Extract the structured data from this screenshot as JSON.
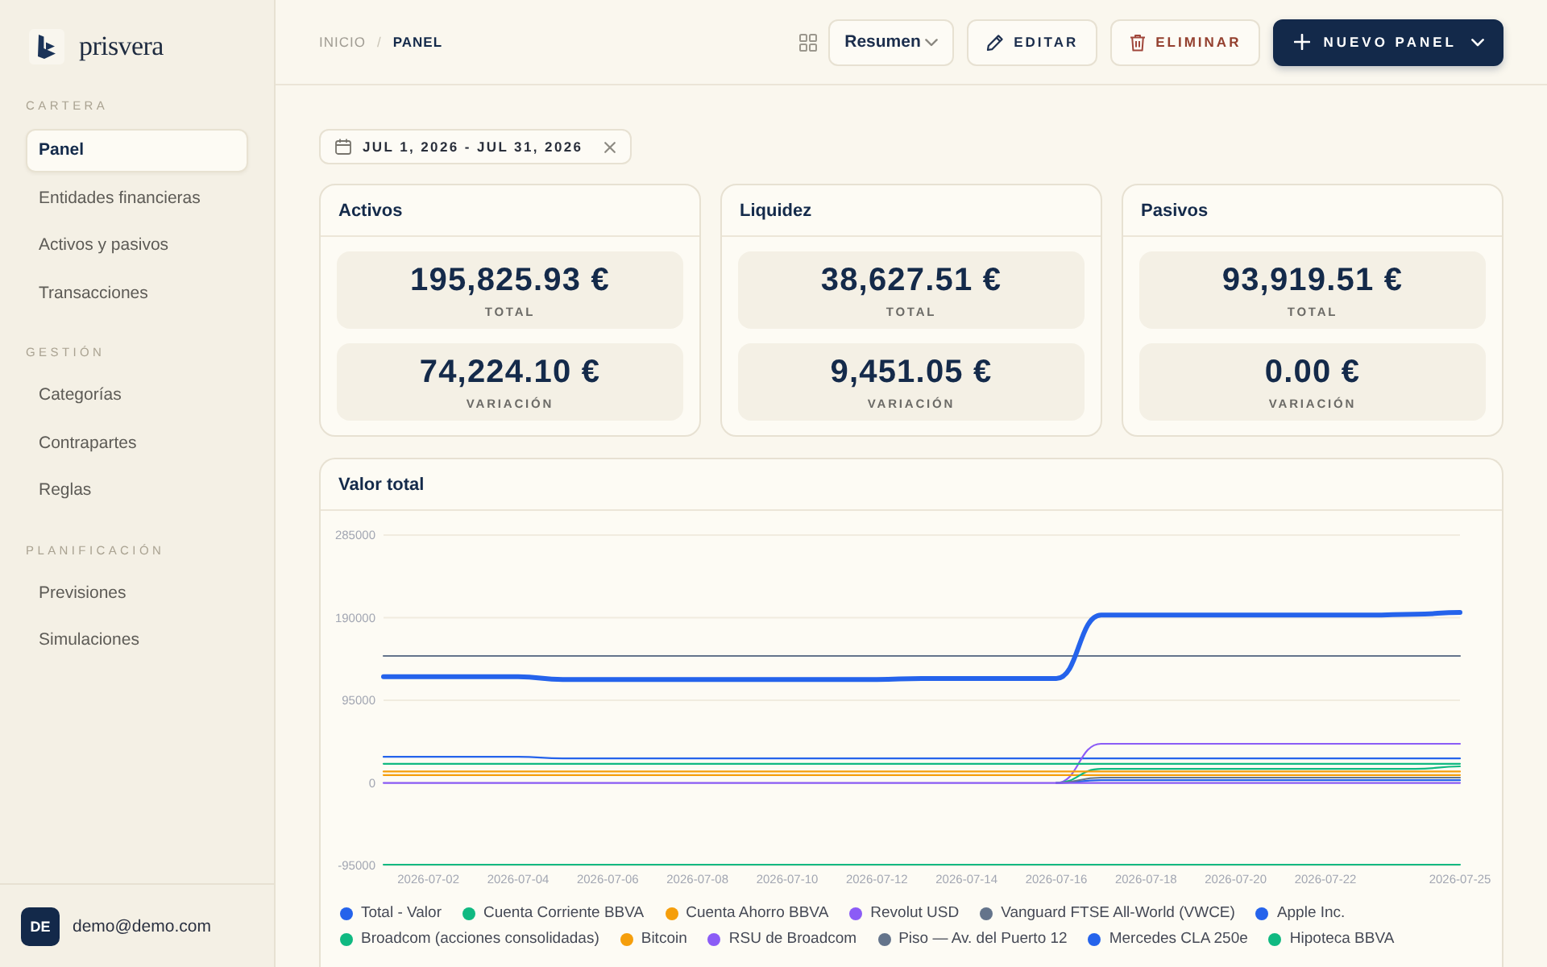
{
  "sidebar": {
    "logo": {
      "text": "prisvera"
    },
    "sections": [
      {
        "title": "CARTERA",
        "items": [
          {
            "label": "Panel",
            "selected": true
          },
          {
            "label": "Entidades financieras",
            "selected": false
          },
          {
            "label": "Activos y pasivos",
            "selected": false
          },
          {
            "label": "Transacciones",
            "selected": false
          }
        ]
      },
      {
        "title": "GESTIÓN",
        "items": [
          {
            "label": "Categorías",
            "selected": false
          },
          {
            "label": "Contrapartes",
            "selected": false
          },
          {
            "label": "Reglas",
            "selected": false
          }
        ]
      },
      {
        "title": "PLANIFICACIÓN",
        "items": [
          {
            "label": "Previsiones",
            "selected": false
          },
          {
            "label": "Simulaciones",
            "selected": false
          }
        ]
      }
    ],
    "user": {
      "initials": "DE",
      "email": "demo@demo.com"
    }
  },
  "breadcrumb": {
    "separator": "/",
    "items": [
      {
        "label": "INICIO",
        "current": false
      },
      {
        "label": "PANEL",
        "current": true
      }
    ]
  },
  "toolbar": {
    "view_select": {
      "value": "Resumen"
    },
    "buttons": [
      {
        "label": "EDITAR",
        "kind": "edit"
      },
      {
        "label": "ELIMINAR",
        "kind": "delete"
      },
      {
        "label": "NUEVO PANEL",
        "kind": "primary"
      }
    ]
  },
  "date_filter": {
    "value": "JUL 1, 2026 - JUL 31, 2026"
  },
  "cards": [
    {
      "title": "Activos",
      "stats": [
        {
          "value": "195,825.93 €",
          "label": "TOTAL"
        },
        {
          "value": "74,224.10 €",
          "label": "VARIACIÓN"
        }
      ]
    },
    {
      "title": "Liquidez",
      "stats": [
        {
          "value": "38,627.51 €",
          "label": "TOTAL"
        },
        {
          "value": "9,451.05 €",
          "label": "VARIACIÓN"
        }
      ]
    },
    {
      "title": "Pasivos",
      "stats": [
        {
          "value": "93,919.51 €",
          "label": "TOTAL"
        },
        {
          "value": "0.00 €",
          "label": "VARIACIÓN"
        }
      ]
    }
  ],
  "chart_card": {
    "title": "Valor total",
    "chart_data": {
      "type": "line",
      "categories": [
        null,
        "2026-07-02",
        null,
        "2026-07-04",
        null,
        "2026-07-06",
        null,
        "2026-07-08",
        null,
        "2026-07-10",
        null,
        "2026-07-12",
        null,
        "2026-07-14",
        null,
        "2026-07-16",
        null,
        "2026-07-18",
        null,
        "2026-07-20",
        null,
        "2026-07-22",
        null,
        null,
        "2026-07-25"
      ],
      "ylim": [
        -95000,
        285000
      ],
      "yticks": [
        -95000,
        0,
        95000,
        190000,
        285000
      ],
      "series": [
        {
          "name": "Total - Valor",
          "color": "#2563eb",
          "values": [
            122000,
            122000,
            122000,
            122000,
            119000,
            119000,
            119000,
            119000,
            119000,
            119000,
            119000,
            119000,
            120000,
            120000,
            120000,
            120000,
            193000,
            193000,
            193000,
            193000,
            193000,
            193000,
            193000,
            194000,
            196000
          ]
        },
        {
          "name": "Cuenta Corriente BBVA",
          "color": "#10b981",
          "values": [
            22000,
            22000,
            22000,
            22000,
            22000,
            22000,
            22000,
            22000,
            22000,
            22000,
            22000,
            22000,
            22000,
            22000,
            22000,
            22000,
            22000,
            22000,
            22000,
            22000,
            22000,
            22000,
            22000,
            22000,
            22000
          ]
        },
        {
          "name": "Cuenta Ahorro BBVA",
          "color": "#f59e0b",
          "values": [
            13000,
            13000,
            13000,
            13000,
            13000,
            13000,
            13000,
            13000,
            13000,
            13000,
            13000,
            13000,
            13000,
            13000,
            13000,
            13000,
            13000,
            13000,
            13000,
            13000,
            13000,
            13000,
            13000,
            13000,
            13000
          ]
        },
        {
          "name": "Revolut USD",
          "color": "#8b5cf6",
          "values": [
            0,
            0,
            0,
            0,
            0,
            0,
            0,
            0,
            0,
            0,
            0,
            0,
            0,
            0,
            0,
            0,
            0,
            0,
            0,
            0,
            0,
            0,
            0,
            0,
            0
          ]
        },
        {
          "name": "Vanguard FTSE All-World (VWCE)",
          "color": "#64748b",
          "values": [
            null,
            null,
            null,
            null,
            null,
            null,
            null,
            null,
            null,
            null,
            null,
            null,
            null,
            null,
            null,
            0,
            6000,
            6000,
            6000,
            6000,
            6000,
            6000,
            6000,
            6000,
            6000
          ]
        },
        {
          "name": "Apple Inc.",
          "color": "#2563eb",
          "values": [
            null,
            null,
            null,
            null,
            null,
            null,
            null,
            null,
            null,
            null,
            null,
            null,
            null,
            null,
            null,
            0,
            3000,
            3000,
            3000,
            3000,
            3000,
            3000,
            3000,
            3000,
            3000
          ]
        },
        {
          "name": "Broadcom (acciones consolidadas)",
          "color": "#10b981",
          "values": [
            null,
            null,
            null,
            null,
            null,
            null,
            null,
            null,
            null,
            null,
            null,
            null,
            null,
            null,
            null,
            0,
            16000,
            16000,
            16000,
            16000,
            16000,
            16000,
            16000,
            16000,
            19000
          ]
        },
        {
          "name": "Bitcoin",
          "color": "#f59e0b",
          "values": [
            9000,
            9000,
            9000,
            9000,
            9000,
            9000,
            9000,
            9000,
            9000,
            9000,
            9000,
            9000,
            9000,
            9000,
            9000,
            9000,
            9000,
            9000,
            9000,
            9000,
            9000,
            9000,
            9000,
            9000,
            9000
          ]
        },
        {
          "name": "RSU de Broadcom",
          "color": "#8b5cf6",
          "values": [
            null,
            null,
            null,
            null,
            null,
            null,
            null,
            null,
            null,
            null,
            null,
            null,
            null,
            null,
            null,
            0,
            45000,
            45000,
            45000,
            45000,
            45000,
            45000,
            45000,
            45000,
            45000
          ]
        },
        {
          "name": "Piso — Av. del Puerto 12",
          "color": "#64748b",
          "values": [
            146000,
            146000,
            146000,
            146000,
            146000,
            146000,
            146000,
            146000,
            146000,
            146000,
            146000,
            146000,
            146000,
            146000,
            146000,
            146000,
            146000,
            146000,
            146000,
            146000,
            146000,
            146000,
            146000,
            146000,
            146000
          ]
        },
        {
          "name": "Mercedes CLA 250e",
          "color": "#2563eb",
          "values": [
            30000,
            30000,
            30000,
            30000,
            28000,
            28000,
            28000,
            28000,
            28000,
            28000,
            28000,
            28000,
            28000,
            28000,
            28000,
            28000,
            28000,
            28000,
            28000,
            28000,
            28000,
            28000,
            28000,
            28000,
            28000
          ]
        },
        {
          "name": "Hipoteca BBVA",
          "color": "#10b981",
          "values": [
            -94000,
            -94000,
            -94000,
            -94000,
            -94000,
            -94000,
            -94000,
            -94000,
            -94000,
            -94000,
            -94000,
            -94000,
            -94000,
            -94000,
            -94000,
            -94000,
            -94000,
            -94000,
            -94000,
            -94000,
            -94000,
            -94000,
            -94000,
            -94000,
            -94000
          ]
        }
      ]
    }
  }
}
